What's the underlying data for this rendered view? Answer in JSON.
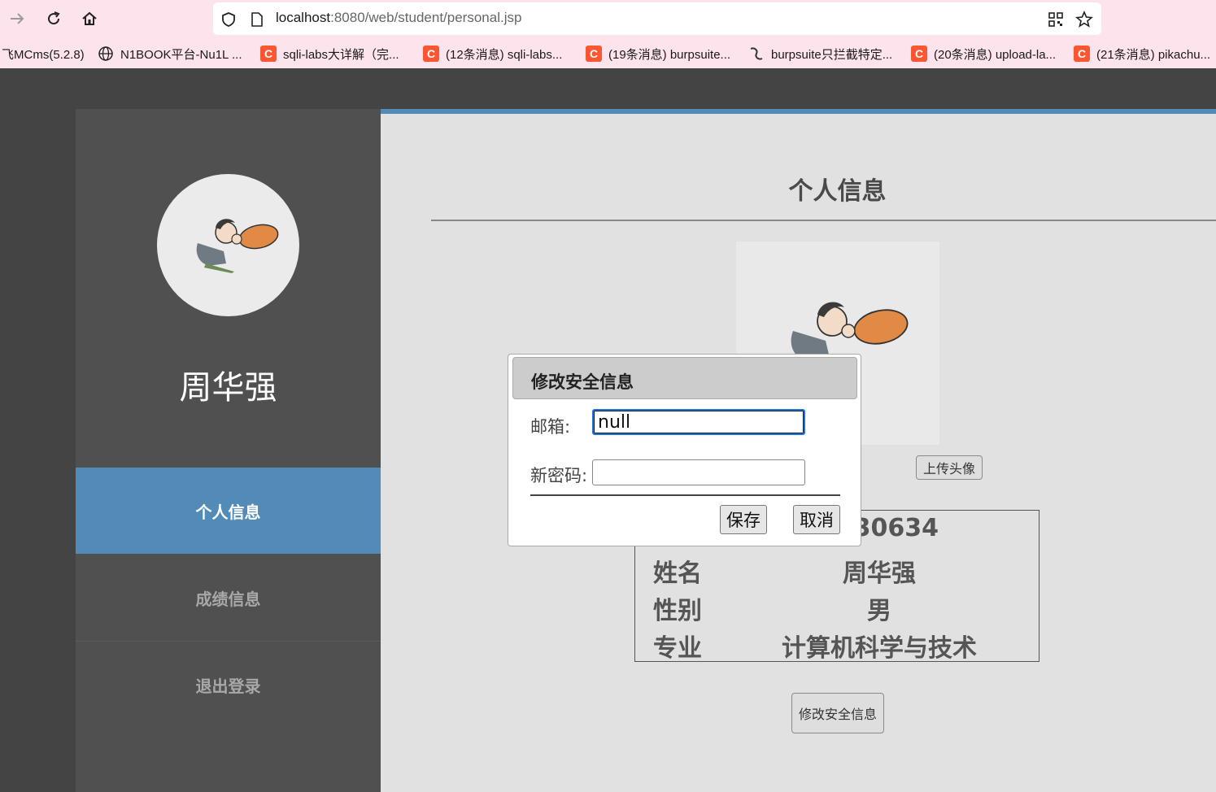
{
  "browser": {
    "url_host": "localhost",
    "url_rest": ":8080/web/student/personal.jsp",
    "bookmarks": [
      {
        "label": "飞MCms(5.2.8)",
        "icon": "none"
      },
      {
        "label": "N1BOOK平台-Nu1L ...",
        "icon": "globe-icon"
      },
      {
        "label": "sqli-labs大详解（完...",
        "icon": "csdn-icon"
      },
      {
        "label": "(12条消息) sqli-labs...",
        "icon": "csdn-icon"
      },
      {
        "label": "(19条消息) burpsuite...",
        "icon": "csdn-icon"
      },
      {
        "label": "burpsuite只拦截特定...",
        "icon": "shape-icon"
      },
      {
        "label": "(20条消息) upload-la...",
        "icon": "csdn-icon"
      },
      {
        "label": "(21条消息) pikachu...",
        "icon": "csdn-icon"
      }
    ],
    "csdn_glyph": "C"
  },
  "sidebar": {
    "name": "周华强",
    "nav": [
      {
        "label": "个人信息",
        "active": true
      },
      {
        "label": "成绩信息",
        "active": false
      },
      {
        "label": "退出登录",
        "active": false
      }
    ]
  },
  "main": {
    "title": "个人信息",
    "upload_button": "上传头像",
    "info": [
      {
        "label": "",
        "value": "2430634"
      },
      {
        "label": "姓名",
        "value": "周华强"
      },
      {
        "label": "性别",
        "value": "男"
      },
      {
        "label": "专业",
        "value": "计算机科学与技术"
      }
    ],
    "security_button": "修改安全信息"
  },
  "modal": {
    "title": "修改安全信息",
    "email_label": "邮箱:",
    "email_value": "null",
    "password_label": "新密码:",
    "password_value": "",
    "save_button": "保存",
    "cancel_button": "取消"
  },
  "colors": {
    "accent": "#518bb6",
    "sidebar_bg": "#505050",
    "main_bg": "#e1e1e1",
    "toolbar_bg": "#fde4ec"
  }
}
